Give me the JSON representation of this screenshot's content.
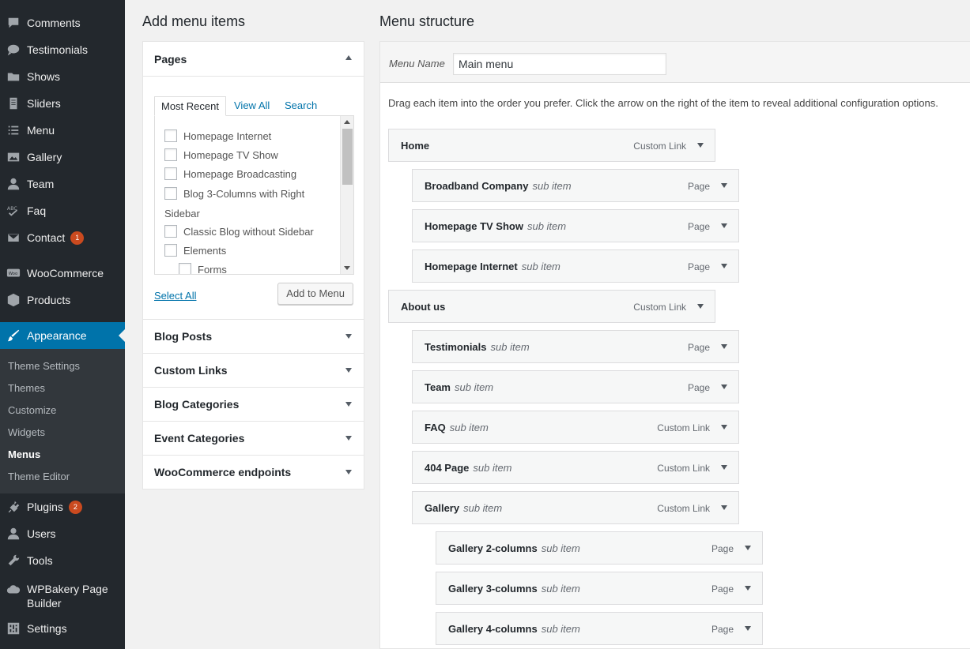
{
  "sidebar": {
    "items": [
      {
        "label": "Comments",
        "icon": "comment-icon"
      },
      {
        "label": "Testimonials",
        "icon": "speech-bubbles-icon"
      },
      {
        "label": "Shows",
        "icon": "folder-icon"
      },
      {
        "label": "Sliders",
        "icon": "document-icon"
      },
      {
        "label": "Menu",
        "icon": "list-icon"
      },
      {
        "label": "Gallery",
        "icon": "image-icon"
      },
      {
        "label": "Team",
        "icon": "user-icon"
      },
      {
        "label": "Faq",
        "icon": "spellcheck-icon"
      },
      {
        "label": "Contact",
        "icon": "mail-icon",
        "badge": "1"
      },
      {
        "label": "WooCommerce",
        "icon": "woo-icon"
      },
      {
        "label": "Products",
        "icon": "cube-icon"
      },
      {
        "label": "Appearance",
        "icon": "paintbrush-icon"
      },
      {
        "label": "Plugins",
        "icon": "plug-icon",
        "badge": "2"
      },
      {
        "label": "Users",
        "icon": "user-icon"
      },
      {
        "label": "Tools",
        "icon": "wrench-icon"
      },
      {
        "label": "WPBakery Page Builder",
        "icon": "cloud-icon"
      },
      {
        "label": "Settings",
        "icon": "settings-icon"
      }
    ],
    "submenu": [
      "Theme Settings",
      "Themes",
      "Customize",
      "Widgets",
      "Menus",
      "Theme Editor"
    ],
    "current_submenu": "Menus"
  },
  "add_items": {
    "title": "Add menu items",
    "pages": {
      "header": "Pages",
      "tabs": [
        "Most Recent",
        "View All",
        "Search"
      ],
      "list": [
        "Homepage Internet",
        "Homepage TV Show",
        "Homepage Broadcasting",
        "Blog 3-Columns with Right",
        "Sidebar",
        "Classic Blog without Sidebar",
        "Elements",
        "Forms"
      ],
      "select_all": "Select All",
      "add_button": "Add to Menu"
    },
    "sections": [
      "Blog Posts",
      "Custom Links",
      "Blog Categories",
      "Event Categories",
      "WooCommerce endpoints"
    ]
  },
  "structure": {
    "title": "Menu structure",
    "menu_name_label": "Menu Name",
    "menu_name_value": "Main menu",
    "instructions": "Drag each item into the order you prefer. Click the arrow on the right of the item to reveal additional configuration options.",
    "sub_label": "sub item",
    "items": [
      {
        "title": "Home",
        "type": "Custom Link",
        "depth": 0
      },
      {
        "title": "Broadband Company",
        "type": "Page",
        "depth": 1
      },
      {
        "title": "Homepage TV Show",
        "type": "Page",
        "depth": 1
      },
      {
        "title": "Homepage Internet",
        "type": "Page",
        "depth": 1
      },
      {
        "title": "About us",
        "type": "Custom Link",
        "depth": 0
      },
      {
        "title": "Testimonials",
        "type": "Page",
        "depth": 1
      },
      {
        "title": "Team",
        "type": "Page",
        "depth": 1
      },
      {
        "title": "FAQ",
        "type": "Custom Link",
        "depth": 1
      },
      {
        "title": "404 Page",
        "type": "Custom Link",
        "depth": 1
      },
      {
        "title": "Gallery",
        "type": "Custom Link",
        "depth": 1
      },
      {
        "title": "Gallery 2-columns",
        "type": "Page",
        "depth": 2
      },
      {
        "title": "Gallery 3-columns",
        "type": "Page",
        "depth": 2
      },
      {
        "title": "Gallery 4-columns",
        "type": "Page",
        "depth": 2
      }
    ]
  }
}
